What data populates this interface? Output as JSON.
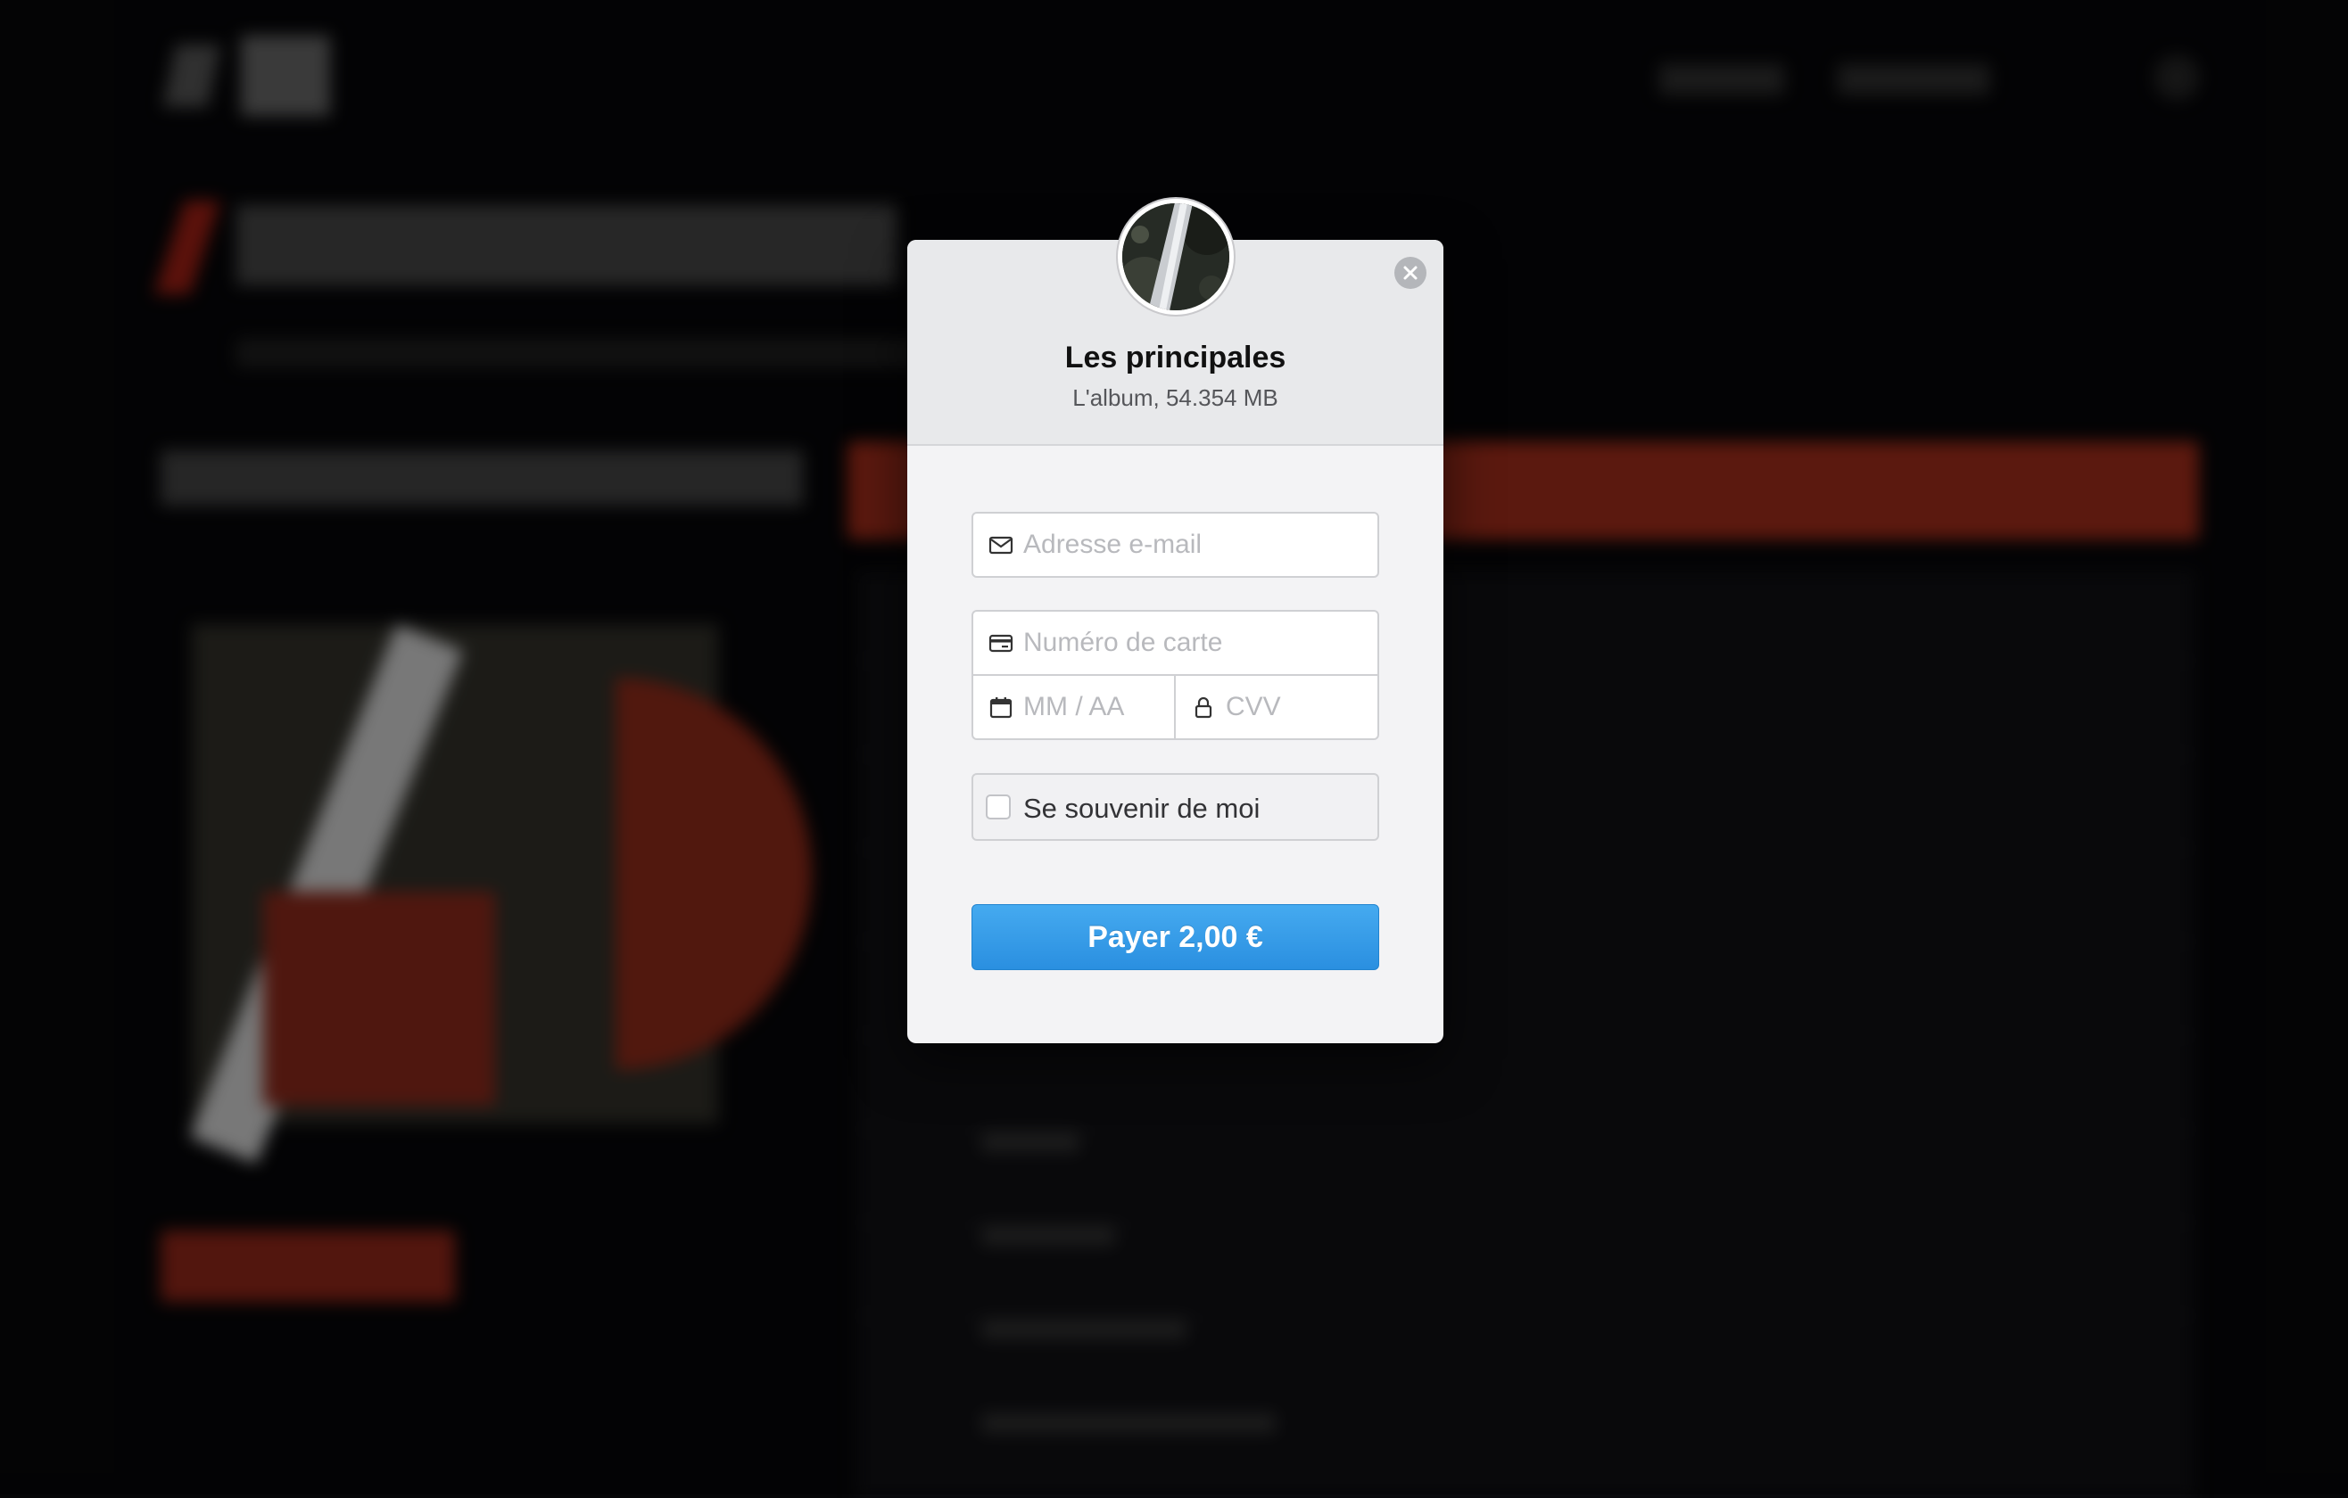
{
  "modal": {
    "title": "Les principales",
    "subtitle": "L'album, 54.354 MB",
    "email_placeholder": "Adresse e-mail",
    "card_placeholder": "Numéro de carte",
    "expiry_placeholder": "MM / AA",
    "cvv_placeholder": "CVV",
    "remember_label": "Se souvenir de moi",
    "pay_label": "Payer 2,00 €",
    "remember_checked": false
  },
  "icons": {
    "close": "close-icon",
    "email": "envelope-icon",
    "card": "credit-card-icon",
    "expiry": "calendar-icon",
    "cvv": "lock-icon"
  },
  "colors": {
    "pay_button": "#3a9ee8",
    "modal_background": "#f3f3f5",
    "header_background": "#e8e9eb",
    "page_accent": "#8d2717"
  }
}
